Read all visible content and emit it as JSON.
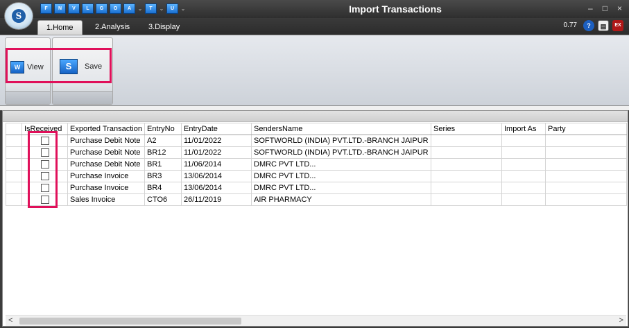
{
  "window": {
    "title": "Import Transactions",
    "minimize": "–",
    "maximize": "□",
    "close": "×"
  },
  "logo": {
    "letter": "S"
  },
  "quick_access": [
    {
      "name": "qat-f-button",
      "label": "F"
    },
    {
      "name": "qat-n-button",
      "label": "N"
    },
    {
      "name": "qat-v-button",
      "label": "V"
    },
    {
      "name": "qat-l-button",
      "label": "L"
    },
    {
      "name": "qat-g-button",
      "label": "G"
    },
    {
      "name": "qat-o-button",
      "label": "O"
    },
    {
      "name": "qat-a-button",
      "label": "A"
    },
    {
      "name": "qat-t-button",
      "label": "T"
    },
    {
      "name": "qat-u-button",
      "label": "U"
    }
  ],
  "tabs": [
    {
      "label": "1.Home",
      "active": true
    },
    {
      "label": "2.Analysis",
      "active": false
    },
    {
      "label": "3.Display",
      "active": false
    }
  ],
  "zoom": "0.77",
  "ribbon": {
    "view_label": "View",
    "save_label": "Save"
  },
  "table": {
    "columns": [
      "IsReceived",
      "Exported Transaction",
      "EntryNo",
      "EntryDate",
      "SendersName",
      "Series",
      "Import As",
      "Party"
    ],
    "rows": [
      {
        "received": false,
        "transaction": "Purchase Debit Note",
        "entry_no": "A2",
        "entry_date": "11/01/2022",
        "sender": "SOFTWORLD (INDIA) PVT.LTD.-BRANCH JAIPUR",
        "series": "",
        "import_as": "",
        "party": ""
      },
      {
        "received": false,
        "transaction": "Purchase Debit Note",
        "entry_no": "BR12",
        "entry_date": "11/01/2022",
        "sender": "SOFTWORLD (INDIA) PVT.LTD.-BRANCH JAIPUR",
        "series": "",
        "import_as": "",
        "party": ""
      },
      {
        "received": false,
        "transaction": "Purchase Debit Note",
        "entry_no": "BR1",
        "entry_date": "11/06/2014",
        "sender": "DMRC PVT LTD...",
        "series": "",
        "import_as": "",
        "party": ""
      },
      {
        "received": false,
        "transaction": "Purchase Invoice",
        "entry_no": "BR3",
        "entry_date": "13/06/2014",
        "sender": "DMRC PVT LTD...",
        "series": "",
        "import_as": "",
        "party": ""
      },
      {
        "received": false,
        "transaction": "Purchase Invoice",
        "entry_no": "BR4",
        "entry_date": "13/06/2014",
        "sender": "DMRC PVT LTD...",
        "series": "",
        "import_as": "",
        "party": ""
      },
      {
        "received": false,
        "transaction": "Sales Invoice",
        "entry_no": "CTO6",
        "entry_date": "26/11/2019",
        "sender": "AIR PHARMACY",
        "series": "",
        "import_as": "",
        "party": ""
      }
    ]
  },
  "scroll": {
    "left": "<",
    "right": ">"
  },
  "colors": {
    "highlight": "#e0105a",
    "title_bar": "#2e2e2e"
  }
}
